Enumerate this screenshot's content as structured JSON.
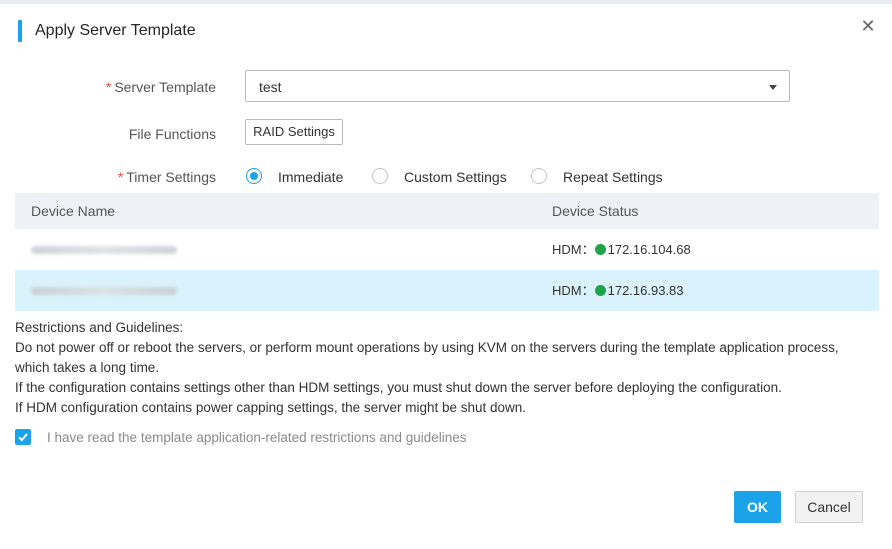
{
  "dialog": {
    "title": "Apply Server Template",
    "close_icon": "close-icon",
    "close_glyph": "✕"
  },
  "form": {
    "server_template": {
      "required_mark": "*",
      "label": "Server Template",
      "value": "test"
    },
    "file_functions": {
      "label": "File Functions",
      "button": "RAID Settings"
    },
    "timer_settings": {
      "required_mark": "*",
      "label": "Timer Settings",
      "options": [
        {
          "label": "Immediate",
          "selected": true
        },
        {
          "label": "Custom Settings",
          "selected": false
        },
        {
          "label": "Repeat Settings",
          "selected": false
        }
      ]
    }
  },
  "table": {
    "columns": [
      "Device Name",
      "Device Status"
    ],
    "rows": [
      {
        "status_prefix": "HDM：",
        "ip": "172.16.104.68",
        "selected": false
      },
      {
        "status_prefix": "HDM：",
        "ip": "172.16.93.83",
        "selected": true
      }
    ]
  },
  "guidelines": {
    "heading": "Restrictions and Guidelines:",
    "lines": [
      "Do not power off or reboot the servers, or perform mount operations by using KVM on the servers during the template application process, which takes a long time.",
      "If the configuration contains settings other than HDM settings, you must shut down the server before deploying the configuration.",
      "If HDM configuration contains power capping settings, the server might be shut down."
    ]
  },
  "acknowledge": {
    "checked": true,
    "label": "I have read the template application-related restrictions and guidelines"
  },
  "footer": {
    "ok_label": "OK",
    "cancel_label": "Cancel"
  },
  "colors": {
    "accent": "#1aa3e8",
    "required": "#e74c3c",
    "status_ok": "#1ea34a",
    "selected_row": "#d9f2fb"
  }
}
